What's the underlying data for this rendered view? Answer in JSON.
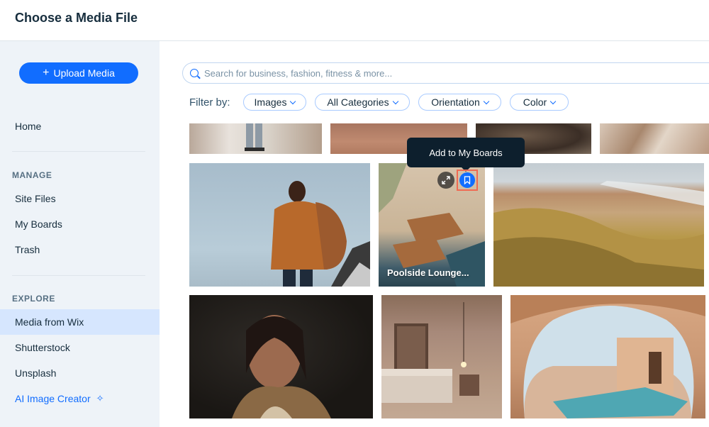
{
  "header": {
    "title": "Choose a Media File"
  },
  "sidebar": {
    "upload_label": "Upload Media",
    "home": "Home",
    "manage_label": "MANAGE",
    "manage_items": [
      "Site Files",
      "My Boards",
      "Trash"
    ],
    "explore_label": "EXPLORE",
    "explore_items": [
      "Media from Wix",
      "Shutterstock",
      "Unsplash"
    ],
    "ai_label": "AI Image Creator",
    "active_item": "Media from Wix"
  },
  "search": {
    "placeholder": "Search for business, fashion, fitness & more..."
  },
  "filters": {
    "label": "Filter by:",
    "chips": [
      "Images",
      "All Categories",
      "Orientation",
      "Color"
    ]
  },
  "tiles": {
    "poolside_label": "Poolside Lounge...",
    "tooltip": "Add to My Boards"
  },
  "colors": {
    "accent": "#116dff",
    "sidebar_bg": "#eef3f8",
    "active_bg": "#d6e6fe",
    "highlight": "#f06a52"
  }
}
